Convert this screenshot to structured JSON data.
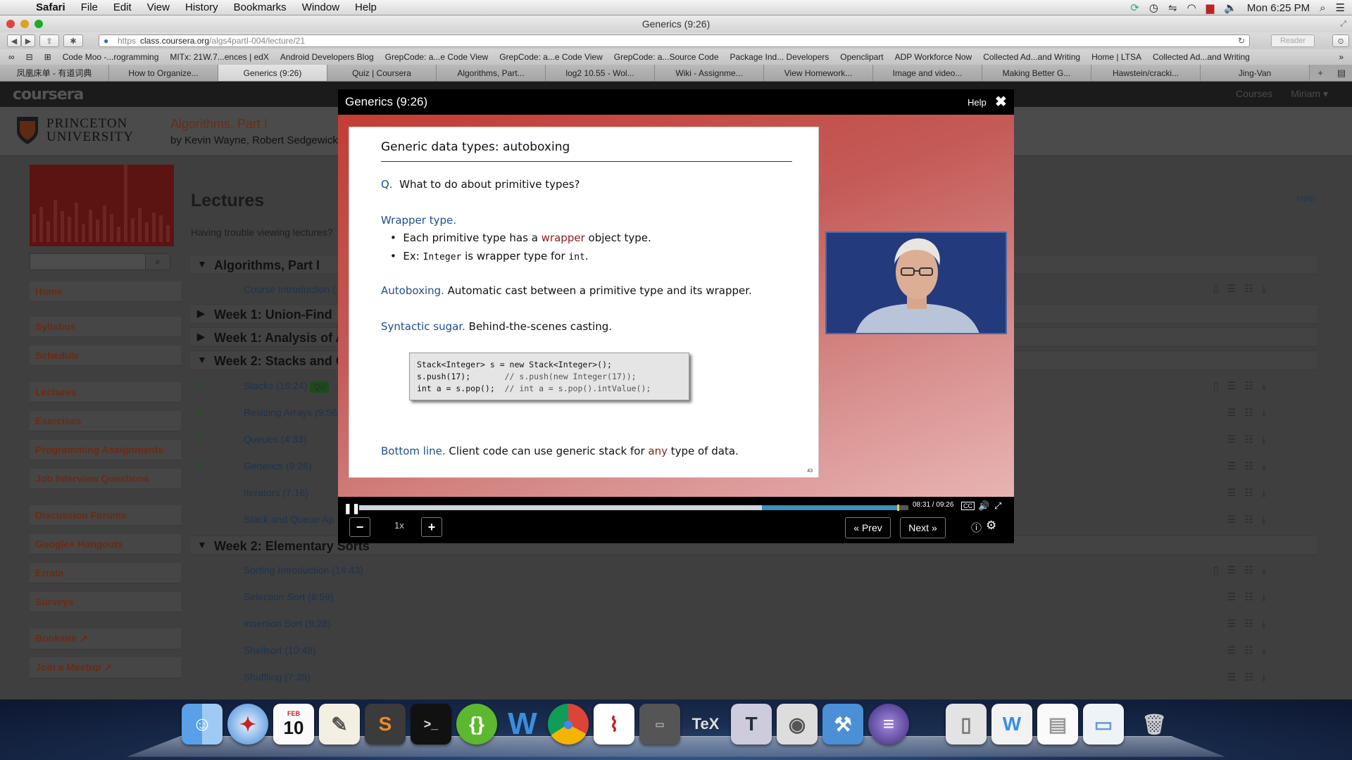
{
  "menubar": {
    "app": "Safari",
    "items": [
      "File",
      "Edit",
      "View",
      "History",
      "Bookmarks",
      "Window",
      "Help"
    ],
    "clock": "Mon 6:25 PM"
  },
  "window": {
    "title": "Generics (9:26)"
  },
  "toolbar": {
    "url_scheme": "https",
    "url_host": "class.coursera.org",
    "url_path": "/algs4partI-004/lecture/21",
    "reader_label": "Reader"
  },
  "bookmarks": [
    "Code Moo -...rogramming",
    "MITx: 21W.7...ences | edX",
    "Android Developers Blog",
    "GrepCode: a...e Code View",
    "GrepCode: a...e Code View",
    "GrepCode: a...Source Code",
    "Package Ind... Developers",
    "Openclipart",
    "ADP Workforce Now",
    "Collected Ad...and Writing",
    "Home | LTSA",
    "Collected Ad...and Writing"
  ],
  "tabs": [
    "凤凰床单 - 有道词典",
    "How to Organize...",
    "Generics (9:26)",
    "Quiz | Coursera",
    "Algorithms, Part...",
    "log2 10.55 - Wol...",
    "Wiki - Assignme...",
    "View Homework...",
    "Image and video...",
    "Making Better G...",
    "Hawstein/cracki...",
    "Jing-Van"
  ],
  "coursera": {
    "logo": "coursera",
    "nav": [
      "Courses",
      "Miriam ▾"
    ],
    "university_line1": "PRINCETON",
    "university_line2": "UNIVERSITY",
    "course_title": "Algorithms, Part I",
    "course_authors": "by Kevin Wayne, Robert Sedgewick",
    "sidebar": [
      "Home",
      "Syllabus",
      "Schedule",
      "Lectures",
      "Exercises",
      "Programming Assignments",
      "Job Interview Questions",
      "Discussion Forums",
      "Google+ Hangouts",
      "Errata",
      "Surveys",
      "Booksite",
      "Join a Meetup"
    ],
    "lectures_heading": "Lectures",
    "trouble_text": "Having trouble viewing lectures?",
    "help_link": "Help",
    "sections": [
      "Algorithms, Part I",
      "Week 1: Union-Find",
      "Week 1: Analysis of A",
      "Week 2: Stacks and Q",
      "Week 2: Elementary Sorts"
    ],
    "items": [
      "Course Introduction (",
      "Stacks (16:24)",
      "Resizing Arrays (9:56",
      "Queues (4:33)",
      "Generics (9:26)",
      "Iterators (7:16)",
      "Stack and Queue Ap",
      "Sorting Introduction (14:43)",
      "Selection Sort (6:59)",
      "Insertion Sort (9:28)",
      "Shellsort (10:48)",
      "Shuffling (7:39)"
    ],
    "quiz_badge": "Qu"
  },
  "player": {
    "title": "Generics (9:26)",
    "help": "Help",
    "close": "✖",
    "time": "08:31 / 09:26",
    "progress": 0.733,
    "buffered": 0.98,
    "speed": "1x",
    "prev": "« Prev",
    "next": "Next »",
    "cc": "CC"
  },
  "slide": {
    "title": "Generic data types:  autoboxing",
    "q_label": "Q.",
    "q_text": "What to do about primitive types?",
    "wrapper_heading": "Wrapper type.",
    "bullet1_a": "Each primitive type has a ",
    "bullet1_b": "wrapper",
    "bullet1_c": " object type.",
    "bullet2_a": "Ex: ",
    "bullet2_b": "Integer",
    "bullet2_c": " is wrapper type for ",
    "bullet2_d": "int",
    "bullet2_e": ".",
    "autoboxing_label": "Autoboxing.",
    "autoboxing_text": " Automatic cast between a primitive type and its wrapper.",
    "sugar_label": "Syntactic sugar.",
    "sugar_text": "  Behind-the-scenes casting.",
    "code1": "Stack<Integer> s = new Stack<Integer>();",
    "code2a": "s.push(17);       ",
    "code2b": "// s.push(new Integer(17));",
    "code3a": "int a = s.pop();  ",
    "code3b": "// int a = s.pop().intValue();",
    "bottom_label": "Bottom line.",
    "bottom_a": "  Client code can use generic stack for ",
    "bottom_b": "any",
    "bottom_c": " type of data.",
    "page": "43"
  },
  "dock_calendar": {
    "month": "FEB",
    "day": "10"
  }
}
